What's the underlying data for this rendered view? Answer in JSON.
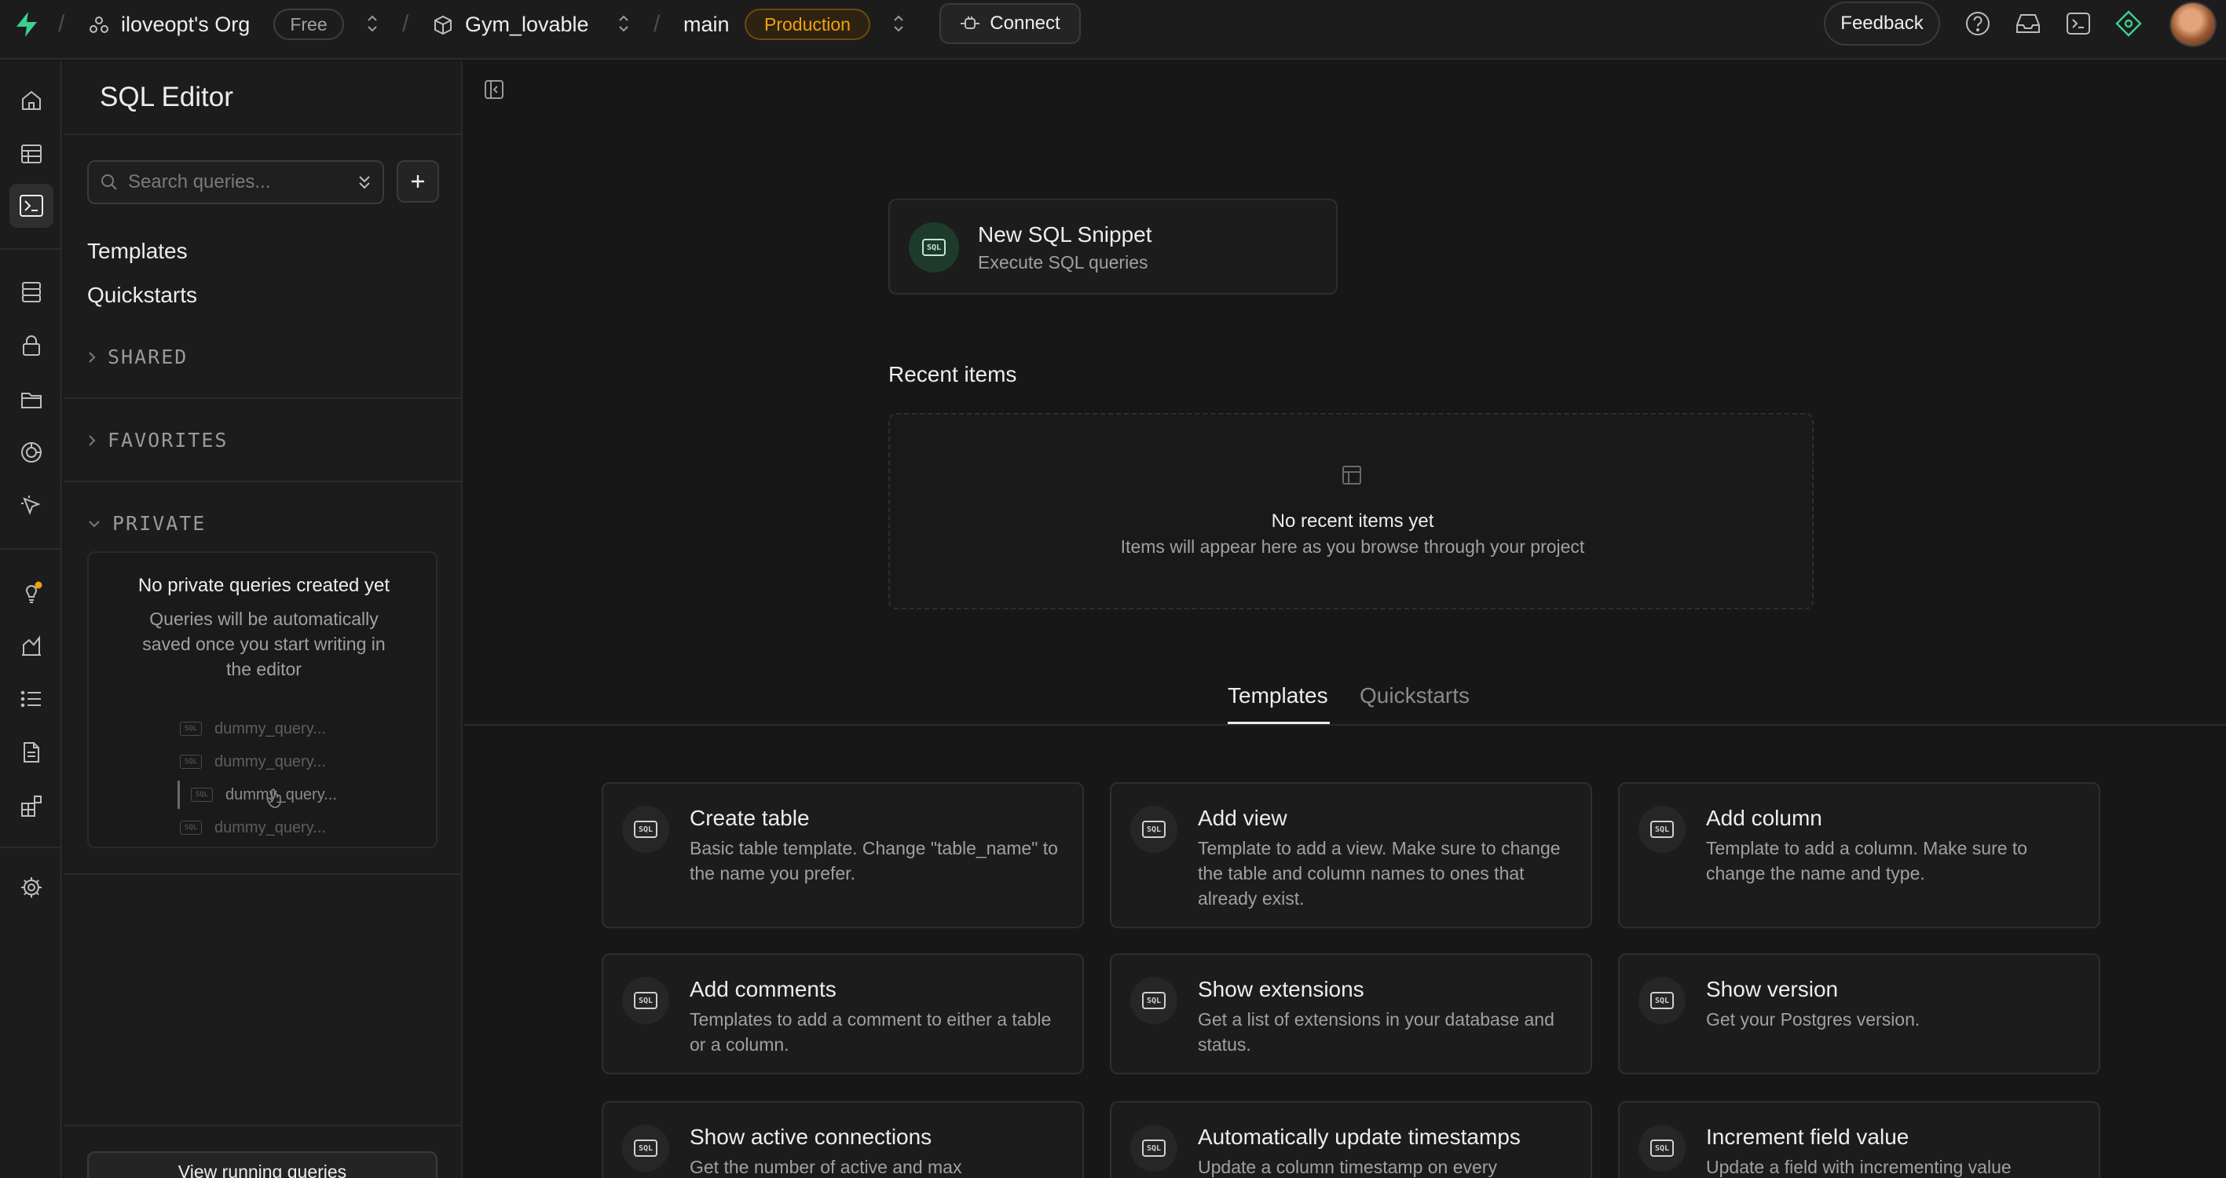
{
  "topbar": {
    "org_name": "iloveopt's Org",
    "org_plan": "Free",
    "project_name": "Gym_lovable",
    "branch_name": "main",
    "branch_env": "Production",
    "connect_label": "Connect",
    "feedback_label": "Feedback",
    "icons": [
      "help-icon",
      "inbox-icon",
      "terminal-icon",
      "advisor-icon"
    ],
    "accent_color": "#3ecf8e"
  },
  "sidebar": {
    "title": "SQL Editor",
    "search_placeholder": "Search queries...",
    "links": [
      "Templates",
      "Quickstarts"
    ],
    "sections": {
      "shared": "SHARED",
      "favorites": "FAVORITES",
      "private": "PRIVATE"
    },
    "private_empty_title": "No private queries created yet",
    "private_empty_desc": "Queries will be automatically saved once you start writing in the editor",
    "dummy_queries": [
      "dummy_query...",
      "dummy_query...",
      "dummy_query...",
      "dummy_query..."
    ],
    "view_running_label": "View running queries"
  },
  "main": {
    "new_snippet_title": "New SQL Snippet",
    "new_snippet_desc": "Execute SQL queries",
    "recent_title": "Recent items",
    "recent_empty_title": "No recent items yet",
    "recent_empty_desc": "Items will appear here as you browse through your project",
    "tabs": [
      "Templates",
      "Quickstarts"
    ],
    "active_tab": "Templates",
    "templates": [
      {
        "title": "Create table",
        "desc": "Basic table template. Change \"table_name\" to the name you prefer."
      },
      {
        "title": "Add view",
        "desc": "Template to add a view. Make sure to change the table and column names to ones that already exist."
      },
      {
        "title": "Add column",
        "desc": "Template to add a column. Make sure to change the name and type."
      },
      {
        "title": "Add comments",
        "desc": "Templates to add a comment to either a table or a column."
      },
      {
        "title": "Show extensions",
        "desc": "Get a list of extensions in your database and status."
      },
      {
        "title": "Show version",
        "desc": "Get your Postgres version."
      },
      {
        "title": "Show active connections",
        "desc": "Get the number of active and max"
      },
      {
        "title": "Automatically update timestamps",
        "desc": "Update a column timestamp on every"
      },
      {
        "title": "Increment field value",
        "desc": "Update a field with incrementing value"
      }
    ]
  }
}
